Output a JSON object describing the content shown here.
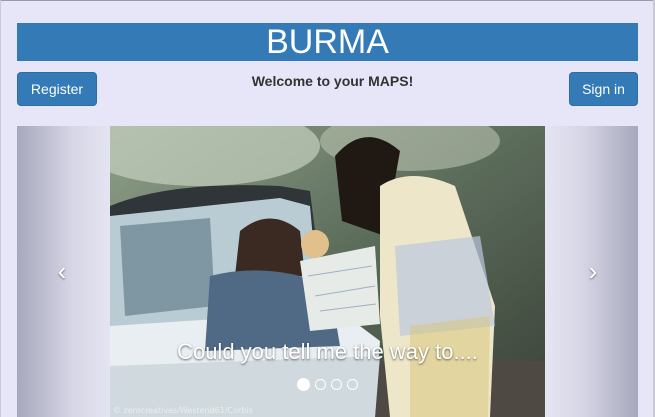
{
  "header": {
    "title": "BURMA"
  },
  "buttons": {
    "register_label": "Register",
    "signin_label": "Sign in"
  },
  "welcome_text": "Welcome to your MAPS!",
  "carousel": {
    "caption": "Could you tell me the way to....",
    "photo_credit": "© zerocreatives/Westend61/Corbis",
    "prev_icon": "chevron-left-icon",
    "next_icon": "chevron-right-icon",
    "slide_count": 4,
    "active_slide": 1
  },
  "colors": {
    "brand": "#337ab7",
    "page_background": "#e6e6f8"
  }
}
